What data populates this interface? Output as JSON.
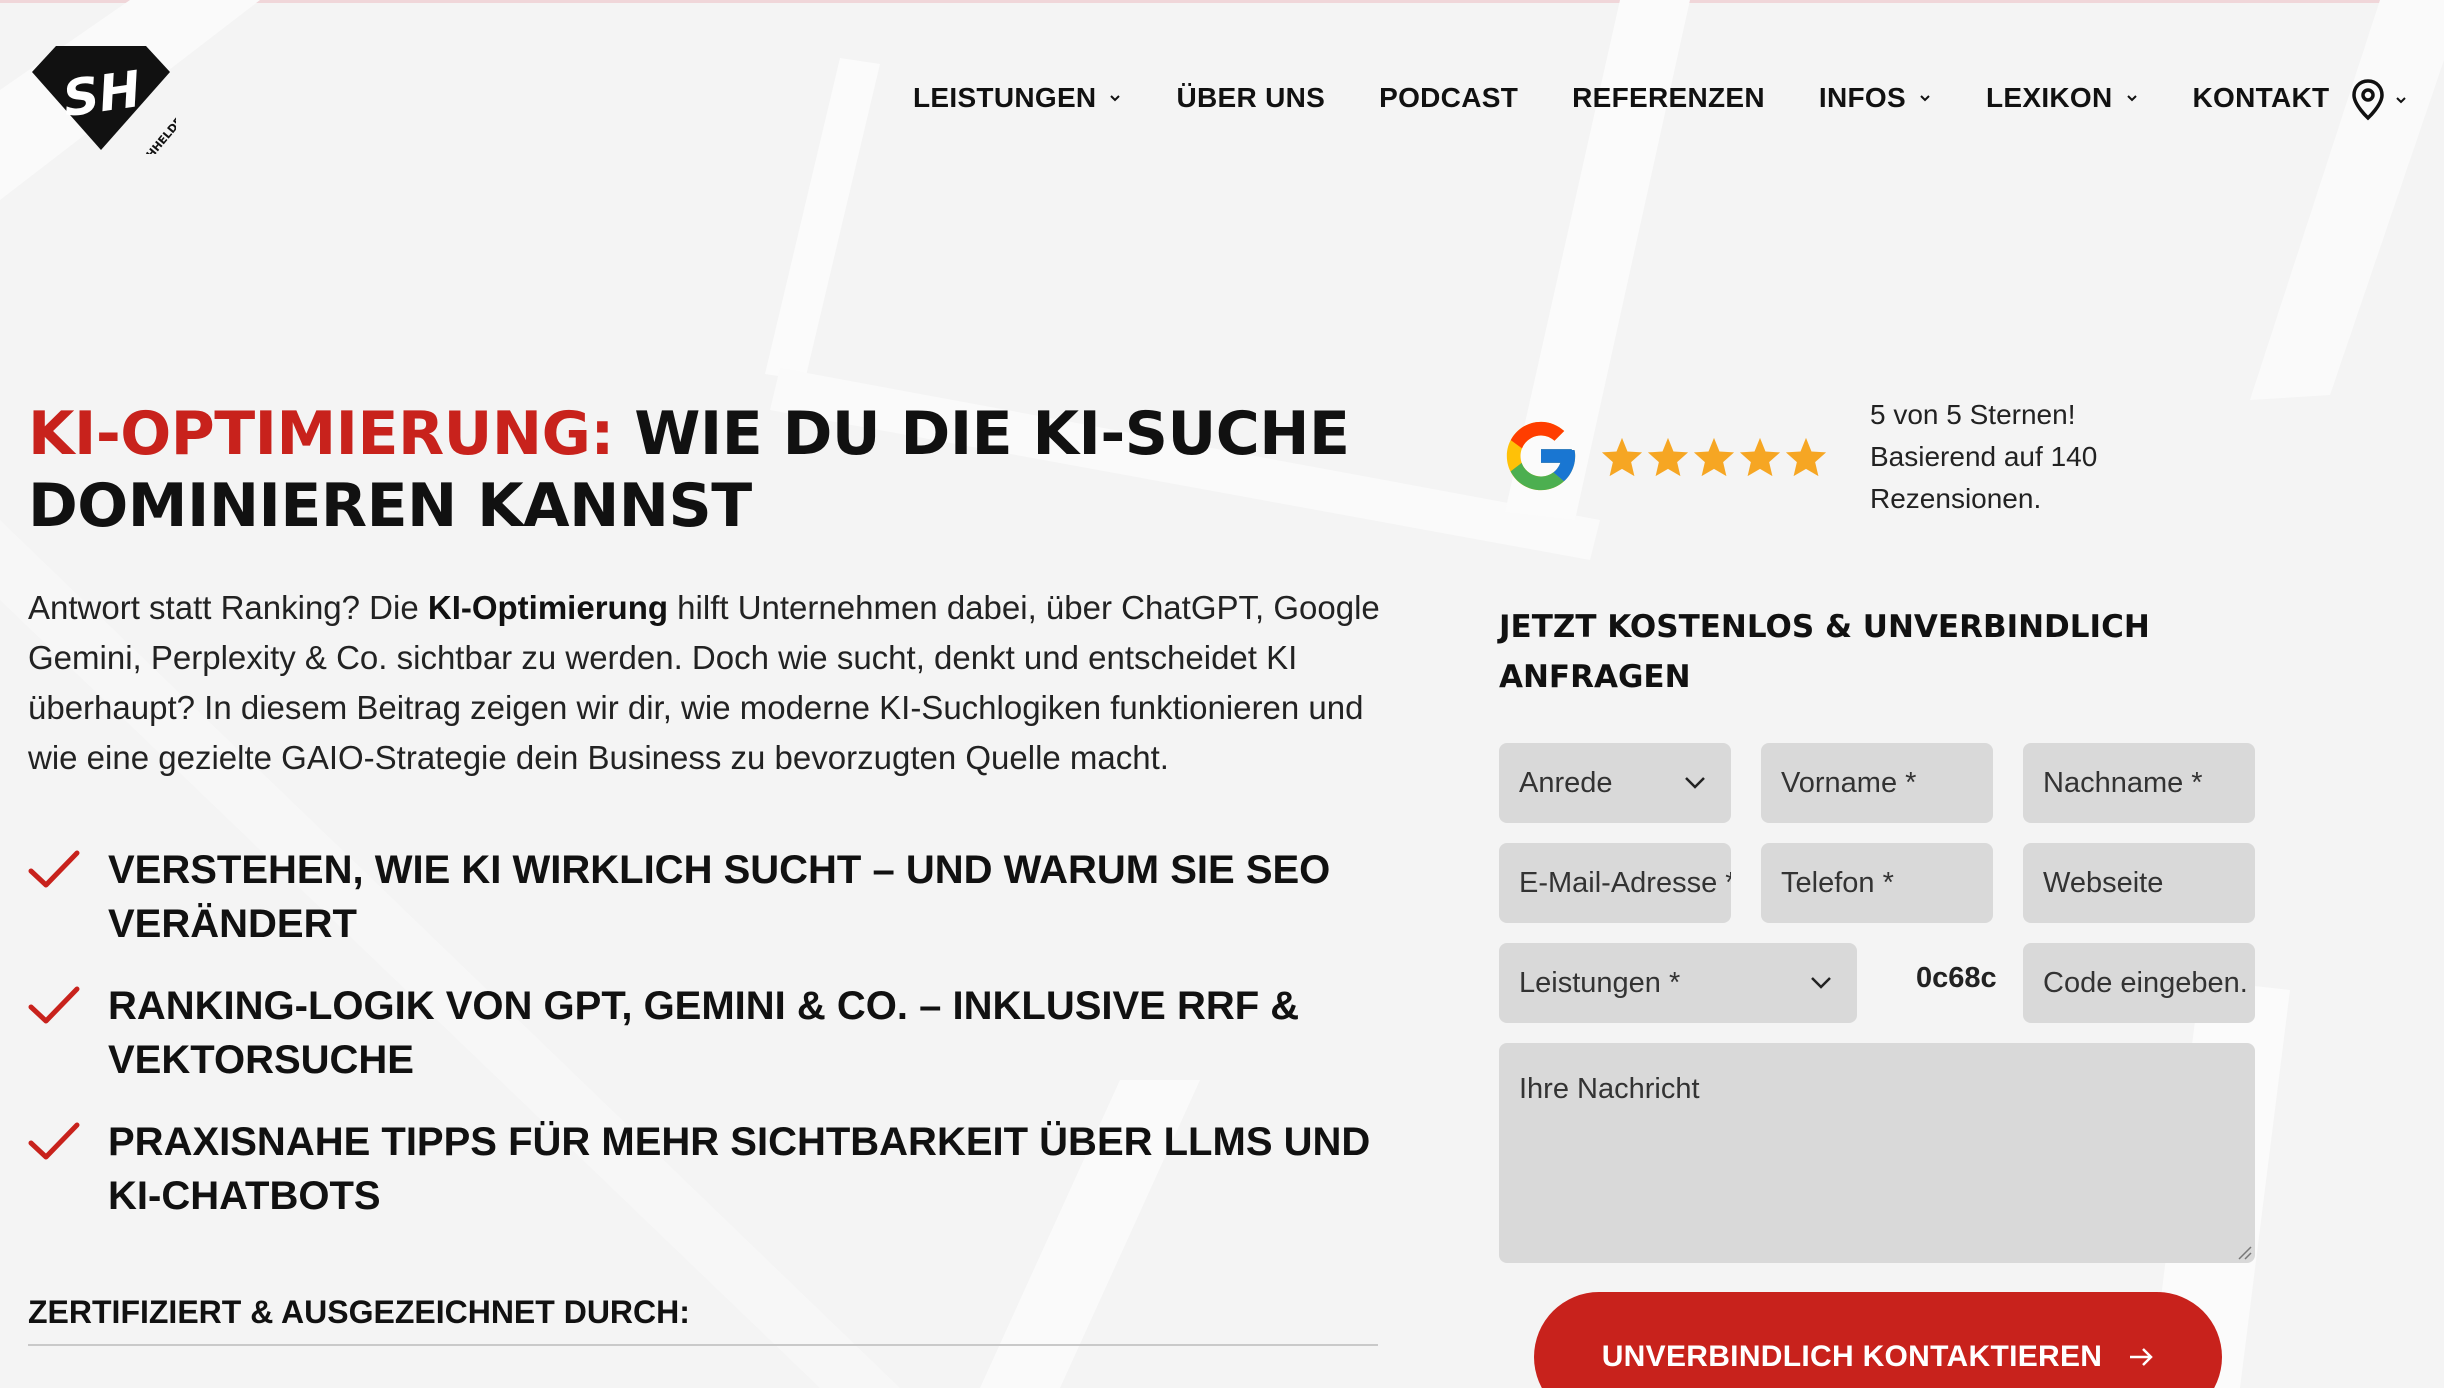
{
  "brand": {
    "logo_initials": "SH",
    "logo_text": "SUCHHELDEN",
    "accent_color": "#c8221c"
  },
  "nav": {
    "items": [
      {
        "label": "LEISTUNGEN",
        "has_dropdown": true
      },
      {
        "label": "ÜBER UNS",
        "has_dropdown": false
      },
      {
        "label": "PODCAST",
        "has_dropdown": false
      },
      {
        "label": "REFERENZEN",
        "has_dropdown": false
      },
      {
        "label": "INFOS",
        "has_dropdown": true
      },
      {
        "label": "LEXIKON",
        "has_dropdown": true
      },
      {
        "label": "KONTAKT",
        "has_dropdown": false
      }
    ],
    "location_icon": "map-pin-icon"
  },
  "hero": {
    "title_highlight": "KI-Optimierung:",
    "title_rest": " Wie du die KI-Suche dominieren kannst",
    "intro_part1": "Antwort statt Ranking? Die ",
    "intro_bold": "KI-Optimierung",
    "intro_part2": " hilft Unternehmen dabei, über ChatGPT, Google Gemini, Perplexity & Co. sichtbar zu werden. Doch wie sucht, denkt und entscheidet KI überhaupt? In diesem Beitrag zeigen wir dir, wie moderne KI-Suchlogiken funktionieren und wie eine gezielte GAIO-Strategie dein Business zu bevorzugten Quelle macht.",
    "checks": [
      "Verstehen, wie KI wirklich sucht – und warum sie SEO verändert",
      "Ranking-Logik von GPT, Gemini & Co. – inklusive RRF & Vektorsuche",
      "Praxisnahe Tipps für mehr Sichtbarkeit über LLMs und KI-Chatbots"
    ],
    "cert_title": "Zertifiziert & ausgezeichnet durch:"
  },
  "rating": {
    "stars": 5,
    "max_stars": 5,
    "star_color": "#f6a623",
    "line1": "5 von 5 Sternen!",
    "line2": "Basierend auf 140",
    "line3": "Rezensionen."
  },
  "form": {
    "title": "Jetzt kostenlos & unverbindlich anfragen",
    "anrede": "Anrede",
    "vorname": "Vorname *",
    "nachname": "Nachname *",
    "email": "E-Mail-Adresse *",
    "telefon": "Telefon *",
    "webseite": "Webseite",
    "leistungen": "Leistungen *",
    "captcha_code": "0c68c",
    "code_placeholder": "Code eingeben.",
    "message_placeholder": "Ihre Nachricht",
    "submit_label": "Unverbindlich kontaktieren"
  }
}
